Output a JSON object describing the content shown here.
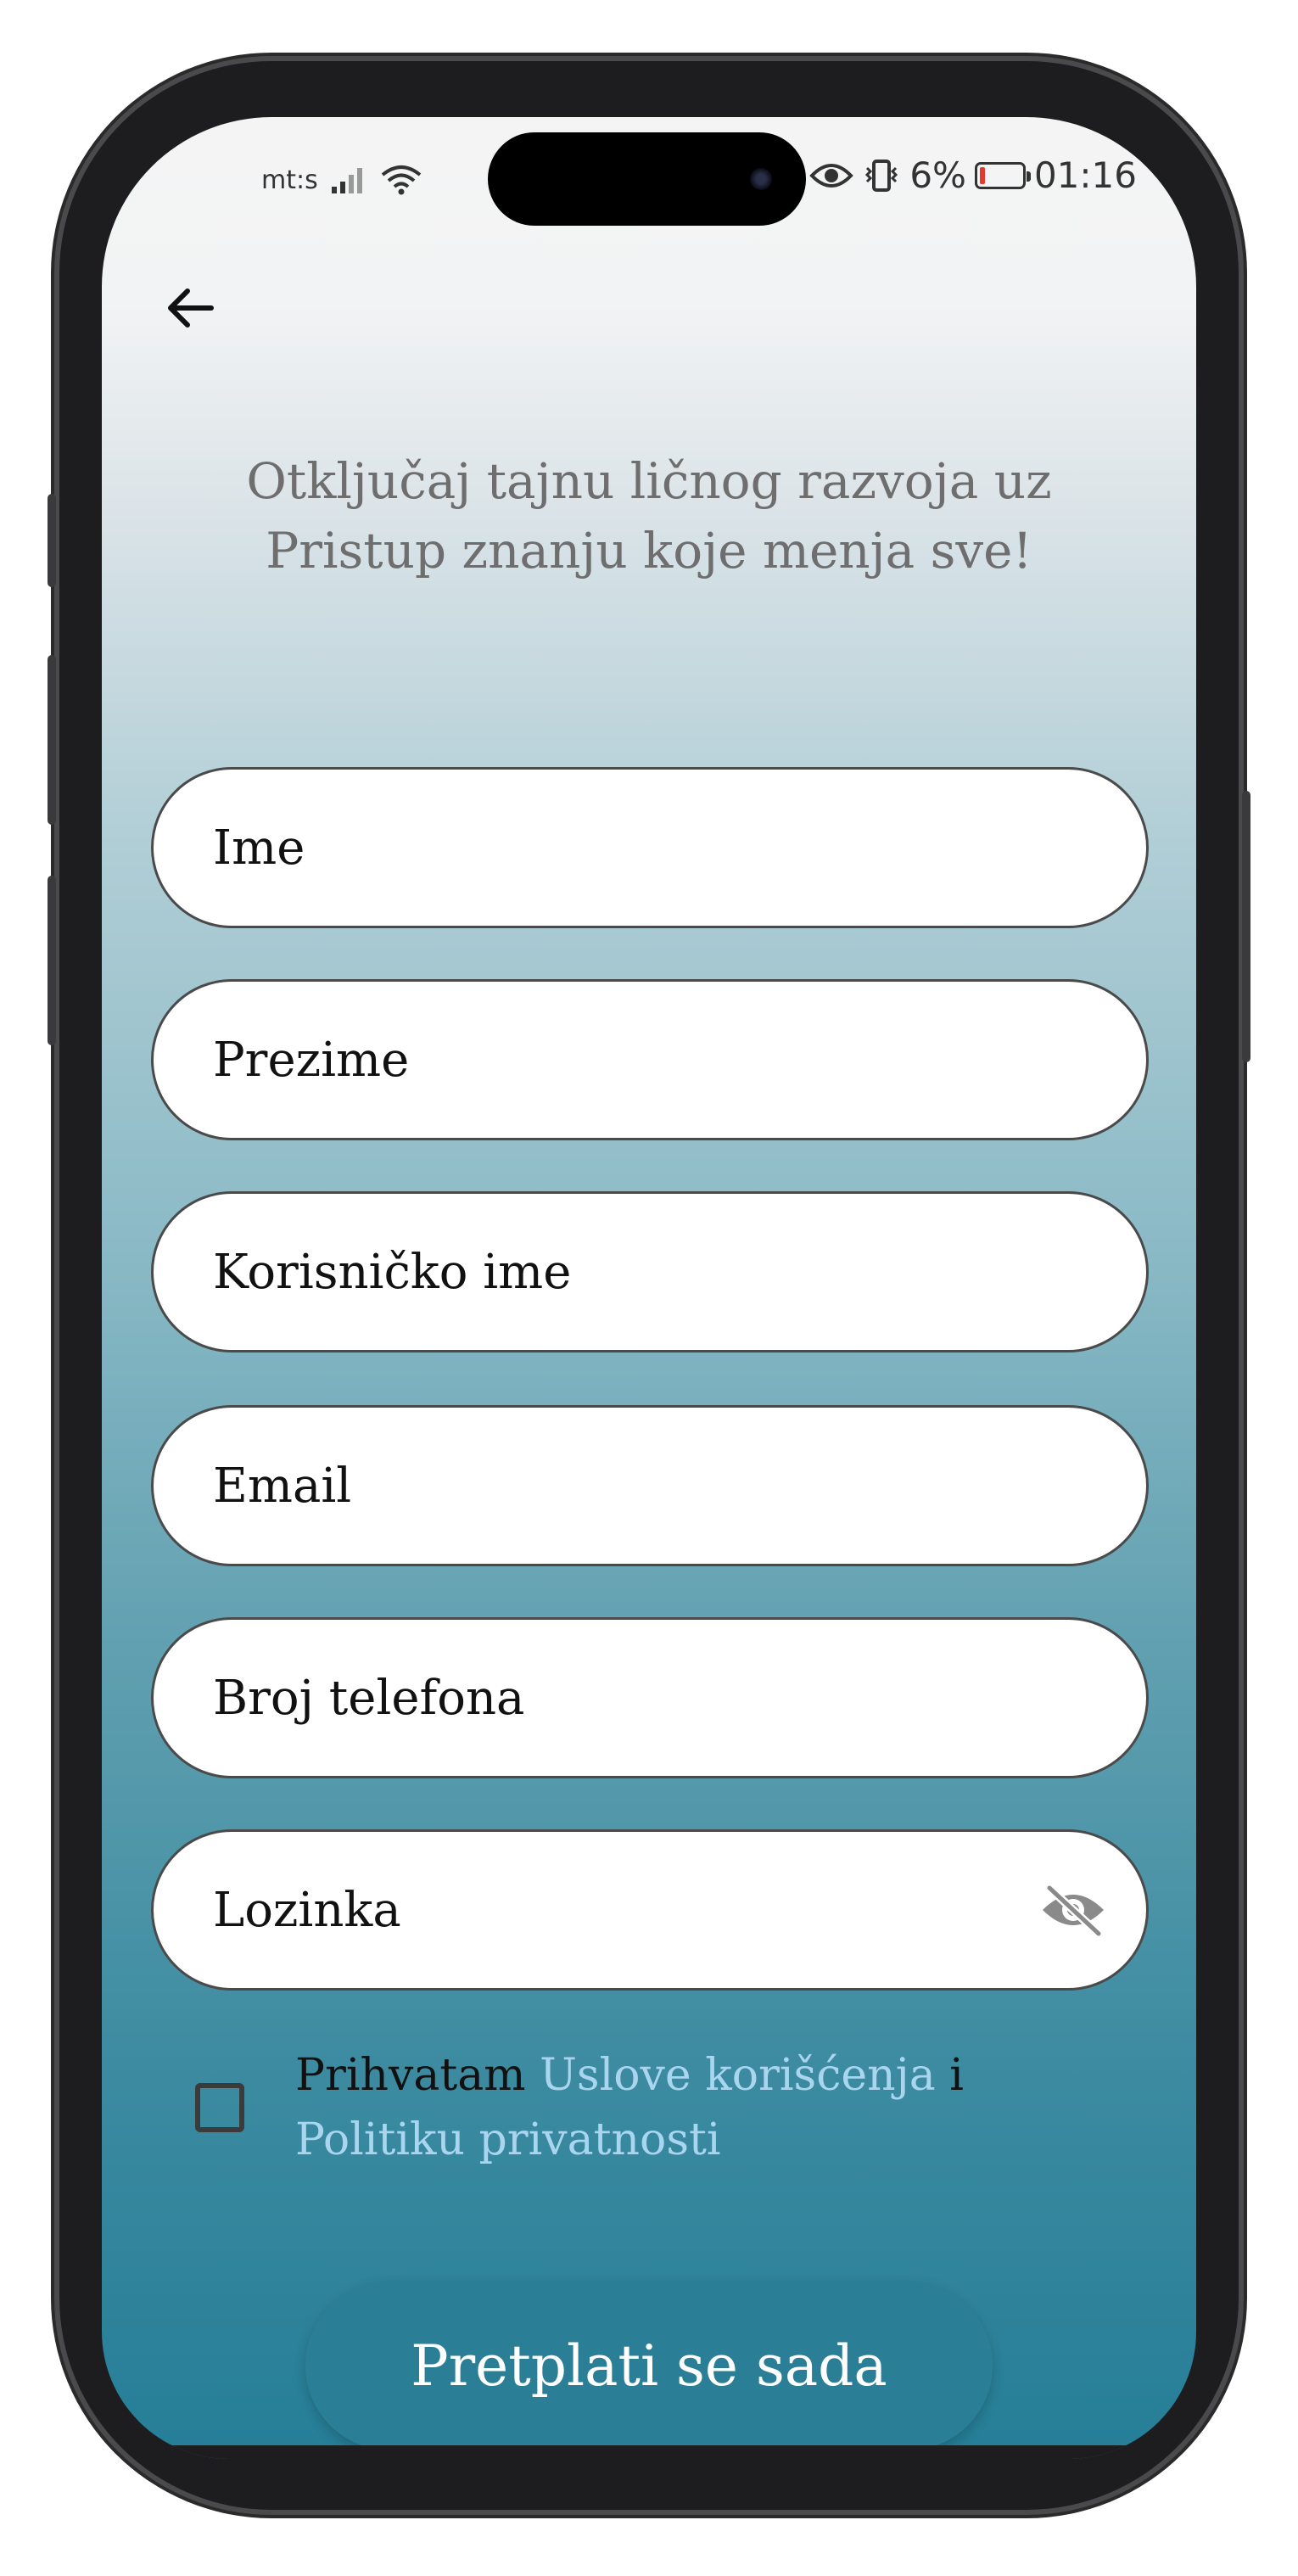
{
  "status_bar": {
    "carrier": "mt:s",
    "battery_percent": "6%",
    "time": "01:16",
    "battery_level": 0.06
  },
  "header": {
    "back_icon": "arrow-left-icon"
  },
  "headline": "Otključaj tajnu ličnog razvoja uz Pristup znanju koje menja sve!",
  "form": {
    "first_name_placeholder": "Ime",
    "last_name_placeholder": "Prezime",
    "username_placeholder": "Korisničko ime",
    "email_placeholder": "Email",
    "phone_placeholder": "Broj telefona",
    "password_placeholder": "Lozinka",
    "password_toggle_icon": "eye-off-icon"
  },
  "terms": {
    "prefix": "Prihvatam",
    "terms_link": "Uslove korišćenja",
    "conjunction": "i",
    "privacy_link": "Politiku privatnosti",
    "checked": false
  },
  "cta_label": "Pretplati se sada",
  "colors": {
    "accent": "#2a7f96",
    "link": "#a9d5ef",
    "battery_low": "#e23b2e"
  }
}
